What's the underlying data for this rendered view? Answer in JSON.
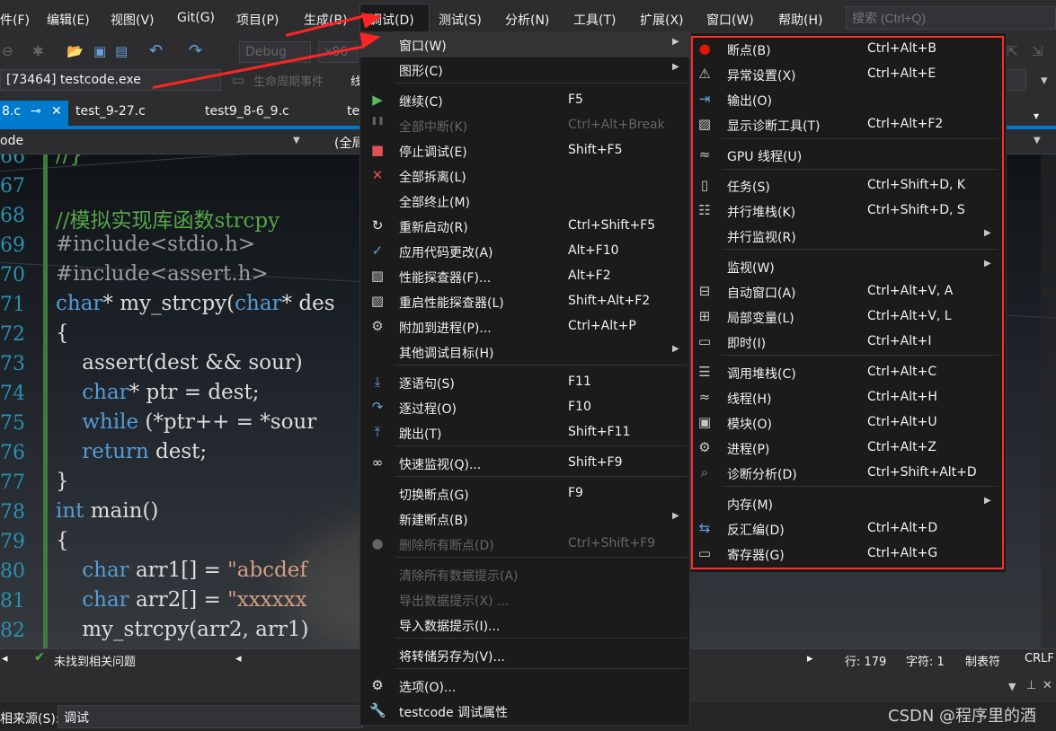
{
  "menubar": {
    "items": [
      "件(F)",
      "编辑(E)",
      "视图(V)",
      "Git(G)",
      "项目(P)",
      "生成(B)",
      "调试(D)",
      "测试(S)",
      "分析(N)",
      "工具(T)",
      "扩展(X)",
      "窗口(W)",
      "帮助(H)"
    ],
    "search_placeholder": "搜索 (Ctrl+Q)"
  },
  "toolbar": {
    "config": "Debug",
    "platform": "x86",
    "process": "[73464] testcode.exe",
    "lifecycle": "生命周期事件",
    "thread_label": "线"
  },
  "tabs": [
    "8.c",
    "test_9-27.c",
    "test9_8-6_9.c",
    "te"
  ],
  "navbar": {
    "left": "ode",
    "right": "(全局"
  },
  "editor": {
    "line_numbers": [
      "66",
      "67",
      "68",
      "69",
      "70",
      "71",
      "72",
      "73",
      "74",
      "75",
      "76",
      "77",
      "78",
      "79",
      "80",
      "81",
      "82"
    ],
    "lines": [
      "//}",
      "",
      "//模拟实现库函数strcpy",
      "#include<stdio.h>",
      "#include<assert.h>",
      "char* my_strcpy(char* des",
      "{",
      "    assert(dest && sour)",
      "    char* ptr = dest;",
      "    while (*ptr++ = *sour",
      "    return dest;",
      "}",
      "int main()",
      "{",
      "    char arr1[] = \"abcdef",
      "    char arr2[] = \"xxxxxx",
      "    my_strcpy(arr2, arr1)"
    ]
  },
  "status": {
    "issues": "未找到相关问题",
    "line": "行: 179",
    "col": "字符: 1",
    "tab": "制表符",
    "eol": "CRLF"
  },
  "bottom_panel": {
    "source_label": "相来源(S):",
    "source_value": "调试"
  },
  "debug_menu": {
    "items": [
      {
        "label": "窗口(W)",
        "shortcut": "",
        "icon": "",
        "submenu": true,
        "disabled": false,
        "highlighted": true
      },
      {
        "label": "图形(C)",
        "shortcut": "",
        "icon": "",
        "submenu": true,
        "disabled": false
      },
      {
        "label": "继续(C)",
        "shortcut": "F5",
        "icon": "play-icon",
        "submenu": false,
        "disabled": false
      },
      {
        "label": "全部中断(K)",
        "shortcut": "Ctrl+Alt+Break",
        "icon": "pause-icon",
        "submenu": false,
        "disabled": true
      },
      {
        "label": "停止调试(E)",
        "shortcut": "Shift+F5",
        "icon": "stop-icon",
        "submenu": false,
        "disabled": false
      },
      {
        "label": "全部拆离(L)",
        "shortcut": "",
        "icon": "detach-x-icon",
        "submenu": false,
        "disabled": false
      },
      {
        "label": "全部终止(M)",
        "shortcut": "",
        "icon": "",
        "submenu": false,
        "disabled": false
      },
      {
        "label": "重新启动(R)",
        "shortcut": "Ctrl+Shift+F5",
        "icon": "restart-icon",
        "submenu": false,
        "disabled": false
      },
      {
        "label": "应用代码更改(A)",
        "shortcut": "Alt+F10",
        "icon": "apply-changes-icon",
        "submenu": false,
        "disabled": false
      },
      {
        "label": "性能探查器(F)...",
        "shortcut": "Alt+F2",
        "icon": "profiler-icon",
        "submenu": false,
        "disabled": false
      },
      {
        "label": "重启性能探查器(L)",
        "shortcut": "Shift+Alt+F2",
        "icon": "profiler-restart-icon",
        "submenu": false,
        "disabled": false
      },
      {
        "label": "附加到进程(P)...",
        "shortcut": "Ctrl+Alt+P",
        "icon": "attach-gears-icon",
        "submenu": false,
        "disabled": false
      },
      {
        "label": "其他调试目标(H)",
        "shortcut": "",
        "icon": "",
        "submenu": true,
        "disabled": false
      },
      {
        "label": "逐语句(S)",
        "shortcut": "F11",
        "icon": "step-into-icon",
        "submenu": false,
        "disabled": false
      },
      {
        "label": "逐过程(O)",
        "shortcut": "F10",
        "icon": "step-over-icon",
        "submenu": false,
        "disabled": false
      },
      {
        "label": "跳出(T)",
        "shortcut": "Shift+F11",
        "icon": "step-out-icon",
        "submenu": false,
        "disabled": false
      },
      {
        "label": "快速监视(Q)...",
        "shortcut": "Shift+F9",
        "icon": "quickwatch-glasses-icon",
        "submenu": false,
        "disabled": false
      },
      {
        "label": "切换断点(G)",
        "shortcut": "F9",
        "icon": "",
        "submenu": false,
        "disabled": false
      },
      {
        "label": "新建断点(B)",
        "shortcut": "",
        "icon": "",
        "submenu": true,
        "disabled": false
      },
      {
        "label": "删除所有断点(D)",
        "shortcut": "Ctrl+Shift+F9",
        "icon": "delete-breakpoints-icon",
        "submenu": false,
        "disabled": true
      },
      {
        "label": "清除所有数据提示(A)",
        "shortcut": "",
        "icon": "",
        "submenu": false,
        "disabled": true
      },
      {
        "label": "导出数据提示(X) ...",
        "shortcut": "",
        "icon": "",
        "submenu": false,
        "disabled": true
      },
      {
        "label": "导入数据提示(I)...",
        "shortcut": "",
        "icon": "",
        "submenu": false,
        "disabled": false
      },
      {
        "label": "将转储另存为(V)...",
        "shortcut": "",
        "icon": "",
        "submenu": false,
        "disabled": false
      },
      {
        "label": "选项(O)...",
        "shortcut": "",
        "icon": "gear-icon",
        "submenu": false,
        "disabled": false
      },
      {
        "label": "testcode 调试属性",
        "shortcut": "",
        "icon": "wrench-icon",
        "submenu": false,
        "disabled": false
      }
    ]
  },
  "window_submenu": {
    "items": [
      {
        "label": "断点(B)",
        "shortcut": "Ctrl+Alt+B",
        "icon": "breakpoint-dot-icon",
        "submenu": false
      },
      {
        "label": "异常设置(X)",
        "shortcut": "Ctrl+Alt+E",
        "icon": "exception-settings-icon",
        "submenu": false
      },
      {
        "label": "输出(O)",
        "shortcut": "",
        "icon": "output-icon",
        "submenu": false
      },
      {
        "label": "显示诊断工具(T)",
        "shortcut": "Ctrl+Alt+F2",
        "icon": "diagnostic-tools-icon",
        "submenu": false
      },
      {
        "label": "GPU 线程(U)",
        "shortcut": "",
        "icon": "gpu-threads-icon",
        "submenu": false
      },
      {
        "label": "任务(S)",
        "shortcut": "Ctrl+Shift+D, K",
        "icon": "tasks-clipboard-icon",
        "submenu": false
      },
      {
        "label": "并行堆栈(K)",
        "shortcut": "Ctrl+Shift+D, S",
        "icon": "parallel-stacks-icon",
        "submenu": false
      },
      {
        "label": "并行监视(R)",
        "shortcut": "",
        "icon": "",
        "submenu": true
      },
      {
        "label": "监视(W)",
        "shortcut": "",
        "icon": "",
        "submenu": true
      },
      {
        "label": "自动窗口(A)",
        "shortcut": "Ctrl+Alt+V, A",
        "icon": "autos-icon",
        "submenu": false
      },
      {
        "label": "局部变量(L)",
        "shortcut": "Ctrl+Alt+V, L",
        "icon": "locals-icon",
        "submenu": false
      },
      {
        "label": "即时(I)",
        "shortcut": "Ctrl+Alt+I",
        "icon": "immediate-icon",
        "submenu": false
      },
      {
        "label": "调用堆栈(C)",
        "shortcut": "Ctrl+Alt+C",
        "icon": "call-stack-icon",
        "submenu": false
      },
      {
        "label": "线程(H)",
        "shortcut": "Ctrl+Alt+H",
        "icon": "threads-icon",
        "submenu": false
      },
      {
        "label": "模块(O)",
        "shortcut": "Ctrl+Alt+U",
        "icon": "modules-icon",
        "submenu": false
      },
      {
        "label": "进程(P)",
        "shortcut": "Ctrl+Alt+Z",
        "icon": "processes-gears-icon",
        "submenu": false
      },
      {
        "label": "诊断分析(D)",
        "shortcut": "Ctrl+Shift+Alt+D",
        "icon": "diagnostic-analysis-icon",
        "submenu": false
      },
      {
        "label": "内存(M)",
        "shortcut": "",
        "icon": "",
        "submenu": true
      },
      {
        "label": "反汇编(D)",
        "shortcut": "Ctrl+Alt+D",
        "icon": "disassembly-icon",
        "submenu": false
      },
      {
        "label": "寄存器(G)",
        "shortcut": "Ctrl+Alt+G",
        "icon": "registers-icon",
        "submenu": false
      }
    ]
  },
  "watermark": "CSDN @程序里的酒",
  "colors": {
    "accent": "#007acc",
    "annotation_red": "#ff2d2d",
    "menu_bg": "#1b1b1c",
    "keyword": "#569cd6",
    "comment": "#57a64a",
    "string": "#d69d85"
  }
}
